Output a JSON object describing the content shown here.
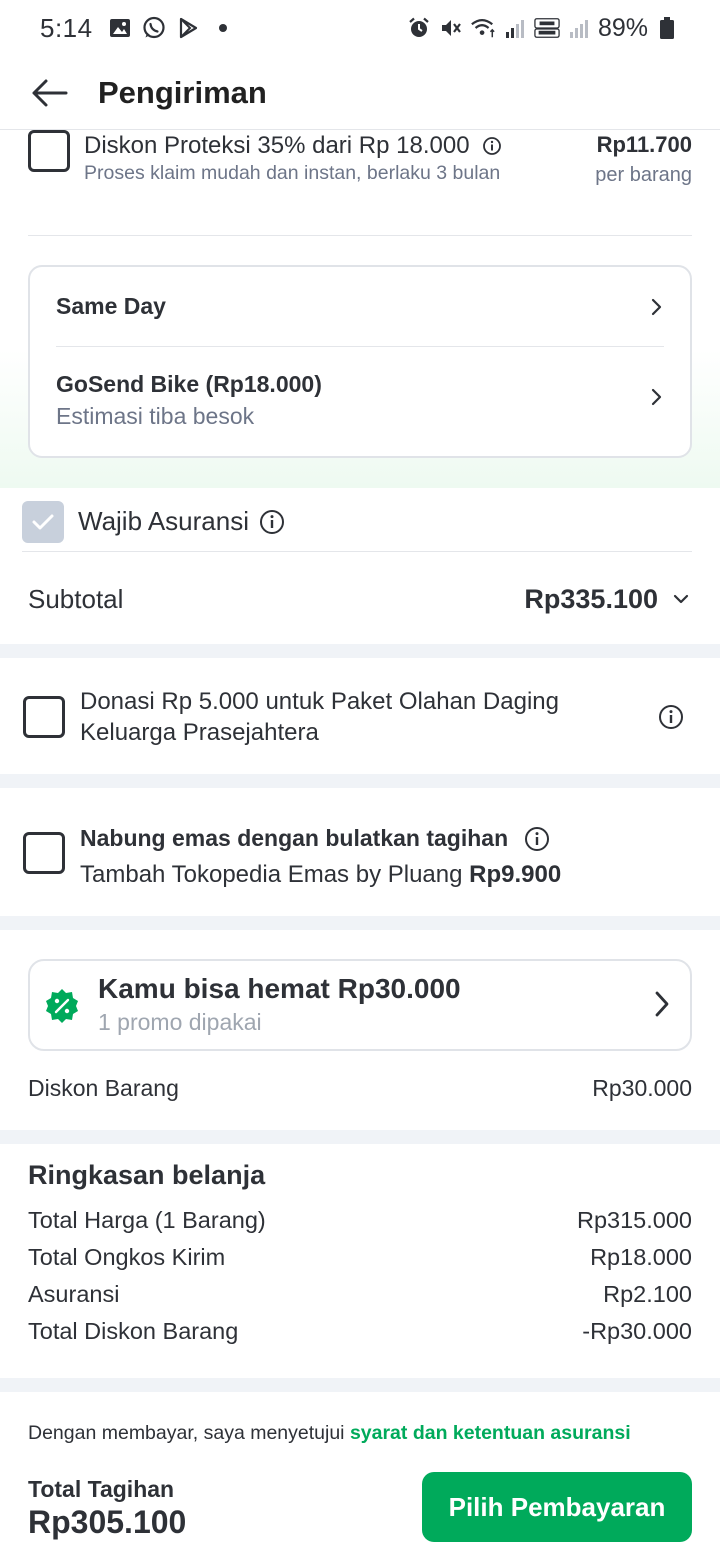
{
  "status_bar": {
    "time": "5:14",
    "battery": "89%"
  },
  "header": {
    "title": "Pengiriman"
  },
  "protection": {
    "title": "Diskon Proteksi 35% dari Rp 18.000",
    "subtitle": "Proses klaim mudah dan instan, berlaku 3 bulan",
    "price": "Rp11.700",
    "unit": "per barang",
    "checked": false
  },
  "shipping": {
    "service": "Same Day",
    "courier": "GoSend Bike (Rp18.000)",
    "estimate": "Estimasi tiba besok"
  },
  "insurance": {
    "label": "Wajib Asuransi",
    "checked": true
  },
  "subtotal": {
    "label": "Subtotal",
    "value": "Rp335.100"
  },
  "donation": {
    "text": "Donasi Rp 5.000 untuk Paket Olahan Daging Keluarga Prasejahtera",
    "checked": false
  },
  "gold": {
    "title": "Nabung emas dengan bulatkan tagihan",
    "subtitle_prefix": "Tambah Tokopedia Emas by Pluang",
    "amount": "Rp9.900",
    "checked": false
  },
  "promo": {
    "title": "Kamu bisa hemat Rp30.000",
    "subtitle": "1 promo dipakai",
    "badge_color": "#00aa5b"
  },
  "item_discount": {
    "label": "Diskon Barang",
    "value": "Rp30.000"
  },
  "summary": {
    "heading": "Ringkasan belanja",
    "rows": [
      {
        "label": "Total Harga (1 Barang)",
        "value": "Rp315.000"
      },
      {
        "label": "Total Ongkos Kirim",
        "value": "Rp18.000"
      },
      {
        "label": "Asuransi",
        "value": "Rp2.100"
      },
      {
        "label": "Total Diskon Barang",
        "value": "-Rp30.000"
      }
    ]
  },
  "footer": {
    "terms_prefix": "Dengan membayar, saya menyetujui",
    "terms_link": "syarat dan ketentuan asuransi",
    "total_label": "Total Tagihan",
    "total_value": "Rp305.100",
    "pay_button": "Pilih Pembayaran",
    "accent_color": "#00aa5b"
  }
}
